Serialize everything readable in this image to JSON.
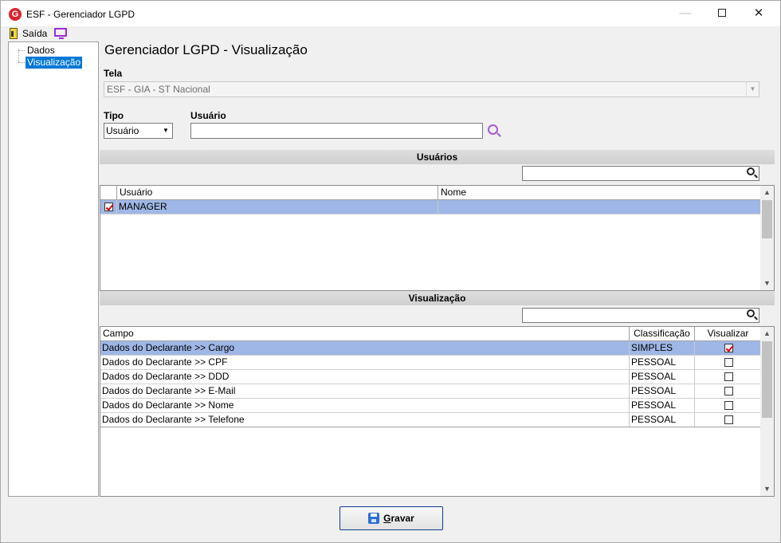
{
  "window": {
    "title": "ESF - Gerenciador LGPD",
    "app_icon_letter": "G",
    "minimize_glyph": "—",
    "close_glyph": "✕"
  },
  "toolbar": {
    "exit_label": "Saída"
  },
  "tree": {
    "items": [
      {
        "label": "Dados"
      },
      {
        "label": "Visualização"
      }
    ]
  },
  "main": {
    "title": "Gerenciador LGPD - Visualização",
    "tela_label": "Tela",
    "tela_value": "ESF - GIA - ST Nacional",
    "tipo_label": "Tipo",
    "tipo_value": "Usuário",
    "usuario_label": "Usuário",
    "usuario_value": ""
  },
  "users_section": {
    "header": "Usuários",
    "filter_value": "",
    "columns": [
      "Usuário",
      "Nome"
    ],
    "rows": [
      {
        "usuario": "MANAGER",
        "nome": "",
        "checked": true
      }
    ]
  },
  "visualizacao_section": {
    "header": "Visualização",
    "filter_value": "",
    "columns": [
      "Campo",
      "Classificação",
      "Visualizar"
    ],
    "rows": [
      {
        "campo": "Dados do Declarante >> Cargo",
        "classificacao": "SIMPLES",
        "visualizar": true
      },
      {
        "campo": "Dados do Declarante >> CPF",
        "classificacao": "PESSOAL",
        "visualizar": false
      },
      {
        "campo": "Dados do Declarante >> DDD",
        "classificacao": "PESSOAL",
        "visualizar": false
      },
      {
        "campo": "Dados do Declarante >> E-Mail",
        "classificacao": "PESSOAL",
        "visualizar": false
      },
      {
        "campo": "Dados do Declarante >> Nome",
        "classificacao": "PESSOAL",
        "visualizar": false
      },
      {
        "campo": "Dados do Declarante >> Telefone",
        "classificacao": "PESSOAL",
        "visualizar": false
      }
    ]
  },
  "footer": {
    "save_label_first": "G",
    "save_label_rest": "ravar"
  },
  "colors": {
    "selection": "#9fb7e6",
    "tree_selection": "#0078d7",
    "accent_icon": "#a35cd6"
  }
}
